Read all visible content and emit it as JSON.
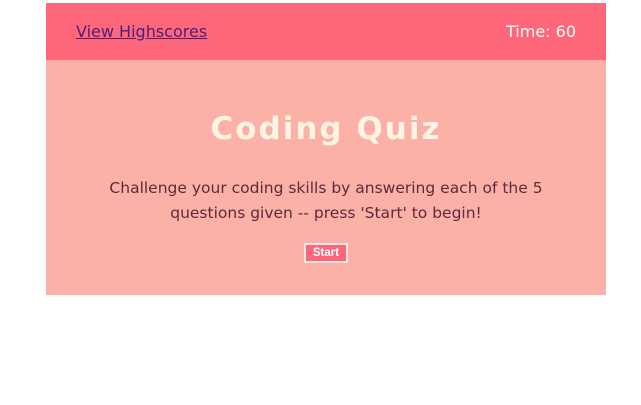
{
  "header": {
    "highscores_link": "View Highscores",
    "timer_text": "Time: 60"
  },
  "main": {
    "title": "Coding Quiz",
    "description": "Challenge your coding skills by answering each of the 5 questions given -- press 'Start' to begin!",
    "start_label": "Start"
  },
  "colors": {
    "header_bg": "#fe6779",
    "card_bg": "#fbb1a6",
    "title_color": "#fff4e3",
    "link_color": "#4b1f7f",
    "text_color": "#5e2a3b",
    "button_bg": "#fe6779"
  }
}
